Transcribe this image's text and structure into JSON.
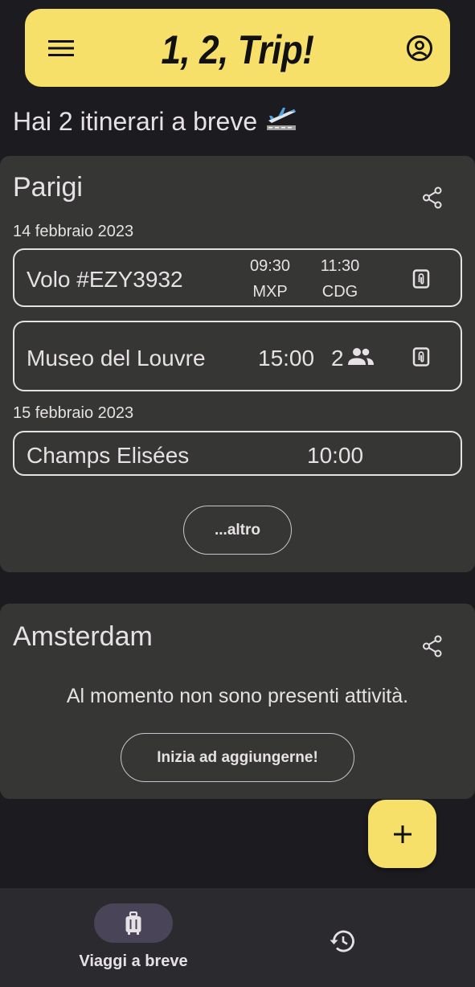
{
  "app": {
    "title": "1, 2, Trip!"
  },
  "greeting": {
    "text": "Hai 2 itinerari a breve"
  },
  "trips": [
    {
      "name": "Parigi",
      "days": [
        {
          "date": "14 febbraio 2023",
          "items": [
            {
              "name": "Volo #EZY3932",
              "depart_time": "09:30",
              "depart_airport": "MXP",
              "arrive_time": "11:30",
              "arrive_airport": "CDG"
            },
            {
              "name": "Museo del Louvre",
              "time": "15:00",
              "people": "2"
            }
          ]
        },
        {
          "date": "15 febbraio 2023",
          "items": [
            {
              "name": "Champs Elisées",
              "time": "10:00"
            }
          ]
        }
      ],
      "more_label": "...altro"
    },
    {
      "name": "Amsterdam",
      "empty_message": "Al momento non sono presenti attività.",
      "add_label": "Inizia ad aggiungerne!"
    }
  ],
  "fab": {
    "label": "+"
  },
  "bottom_nav": {
    "items": [
      {
        "label": "Viaggi a breve",
        "icon": "luggage-icon",
        "active": true
      },
      {
        "label": "",
        "icon": "history-icon",
        "active": false
      }
    ]
  },
  "colors": {
    "accent": "#f7e06a",
    "background": "#1c1b1f",
    "card": "#363634",
    "nav": "#2b2a2e",
    "active_pill": "#4a4458"
  }
}
